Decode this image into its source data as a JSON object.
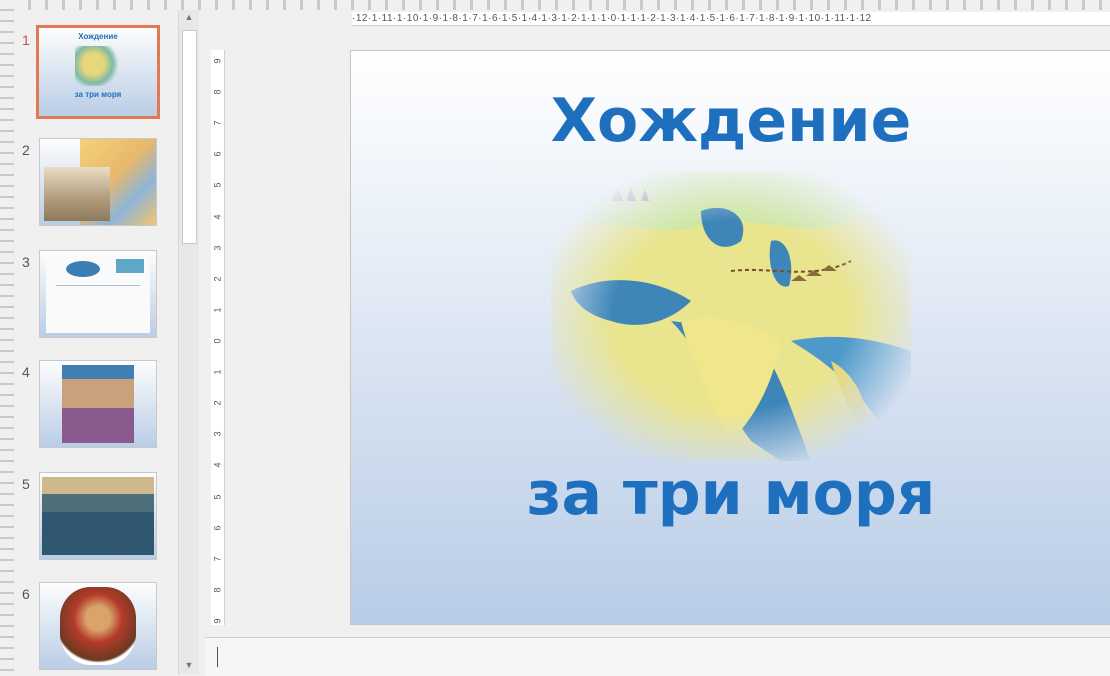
{
  "thumbnails": [
    {
      "num": "1",
      "title": "Хождение",
      "subtitle": "за три моря"
    },
    {
      "num": "2"
    },
    {
      "num": "3"
    },
    {
      "num": "4"
    },
    {
      "num": "5"
    },
    {
      "num": "6"
    }
  ],
  "ruler": {
    "horizontal": "·12·1·11·1·10·1·9·1·8·1·7·1·6·1·5·1·4·1·3·1·2·1·1·1·0·1·1·1·2·1·3·1·4·1·5·1·6·1·7·1·8·1·9·1·10·1·11·1·12",
    "vertical": [
      "9",
      "8",
      "7",
      "6",
      "5",
      "4",
      "3",
      "2",
      "1",
      "0",
      "1",
      "2",
      "3",
      "4",
      "5",
      "6",
      "7",
      "8",
      "9"
    ]
  },
  "slide": {
    "title": "Хождение",
    "subtitle": "за три моря"
  },
  "colors": {
    "title": "#1f6fbf",
    "selected_border": "#e07a55"
  }
}
